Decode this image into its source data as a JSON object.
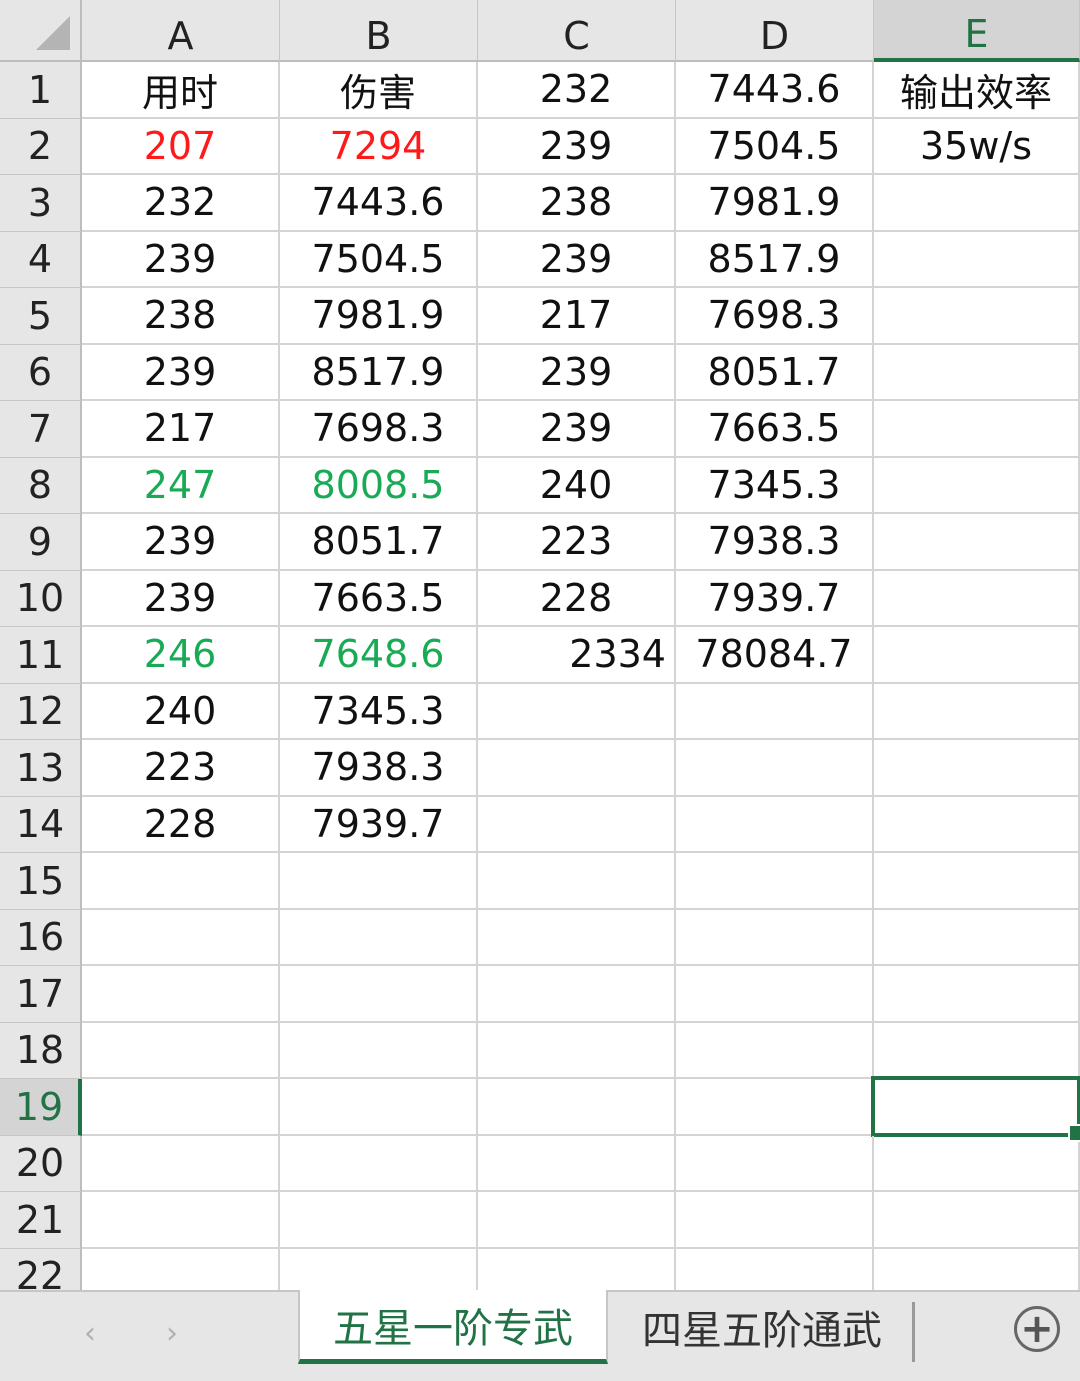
{
  "columns": [
    "A",
    "B",
    "C",
    "D",
    "E"
  ],
  "active_column": "E",
  "rows": [
    "1",
    "2",
    "3",
    "4",
    "5",
    "6",
    "7",
    "8",
    "9",
    "10",
    "11",
    "12",
    "13",
    "14",
    "15",
    "16",
    "17",
    "18",
    "19",
    "20",
    "21",
    "22"
  ],
  "active_row": "19",
  "cells": [
    [
      {
        "v": "用时"
      },
      {
        "v": "伤害"
      },
      {
        "v": "232"
      },
      {
        "v": "7443.6"
      },
      {
        "v": "输出效率"
      }
    ],
    [
      {
        "v": "207",
        "color": "red"
      },
      {
        "v": "7294",
        "color": "red"
      },
      {
        "v": "239"
      },
      {
        "v": "7504.5"
      },
      {
        "v": "35w/s"
      }
    ],
    [
      {
        "v": "232"
      },
      {
        "v": "7443.6"
      },
      {
        "v": "238"
      },
      {
        "v": "7981.9"
      },
      {
        "v": ""
      }
    ],
    [
      {
        "v": "239"
      },
      {
        "v": "7504.5"
      },
      {
        "v": "239"
      },
      {
        "v": "8517.9"
      },
      {
        "v": ""
      }
    ],
    [
      {
        "v": "238"
      },
      {
        "v": "7981.9"
      },
      {
        "v": "217"
      },
      {
        "v": "7698.3"
      },
      {
        "v": ""
      }
    ],
    [
      {
        "v": "239"
      },
      {
        "v": "8517.9"
      },
      {
        "v": "239"
      },
      {
        "v": "8051.7"
      },
      {
        "v": ""
      }
    ],
    [
      {
        "v": "217"
      },
      {
        "v": "7698.3"
      },
      {
        "v": "239"
      },
      {
        "v": "7663.5"
      },
      {
        "v": ""
      }
    ],
    [
      {
        "v": "247",
        "color": "green"
      },
      {
        "v": "8008.5",
        "color": "green"
      },
      {
        "v": "240"
      },
      {
        "v": "7345.3"
      },
      {
        "v": ""
      }
    ],
    [
      {
        "v": "239"
      },
      {
        "v": "8051.7"
      },
      {
        "v": "223"
      },
      {
        "v": "7938.3"
      },
      {
        "v": ""
      }
    ],
    [
      {
        "v": "239"
      },
      {
        "v": "7663.5"
      },
      {
        "v": "228"
      },
      {
        "v": "7939.7"
      },
      {
        "v": ""
      }
    ],
    [
      {
        "v": "246",
        "color": "green"
      },
      {
        "v": "7648.6",
        "color": "green"
      },
      {
        "v": "2334",
        "align": "right"
      },
      {
        "v": "78084.7"
      },
      {
        "v": ""
      }
    ],
    [
      {
        "v": "240"
      },
      {
        "v": "7345.3"
      },
      {
        "v": ""
      },
      {
        "v": ""
      },
      {
        "v": ""
      }
    ],
    [
      {
        "v": "223"
      },
      {
        "v": "7938.3"
      },
      {
        "v": ""
      },
      {
        "v": ""
      },
      {
        "v": ""
      }
    ],
    [
      {
        "v": "228"
      },
      {
        "v": "7939.7"
      },
      {
        "v": ""
      },
      {
        "v": ""
      },
      {
        "v": ""
      }
    ]
  ],
  "selected_cell": "E19",
  "sheet_tabs": {
    "active": "五星一阶专武",
    "inactive": "四星五阶通武"
  },
  "icons": {
    "prev_sheet": "chevron-left-icon",
    "next_sheet": "chevron-right-icon",
    "add_sheet": "plus-circle-icon"
  },
  "colors": {
    "accent": "#217346",
    "red_text": "#ff1a1a",
    "green_text": "#1aaa55"
  }
}
